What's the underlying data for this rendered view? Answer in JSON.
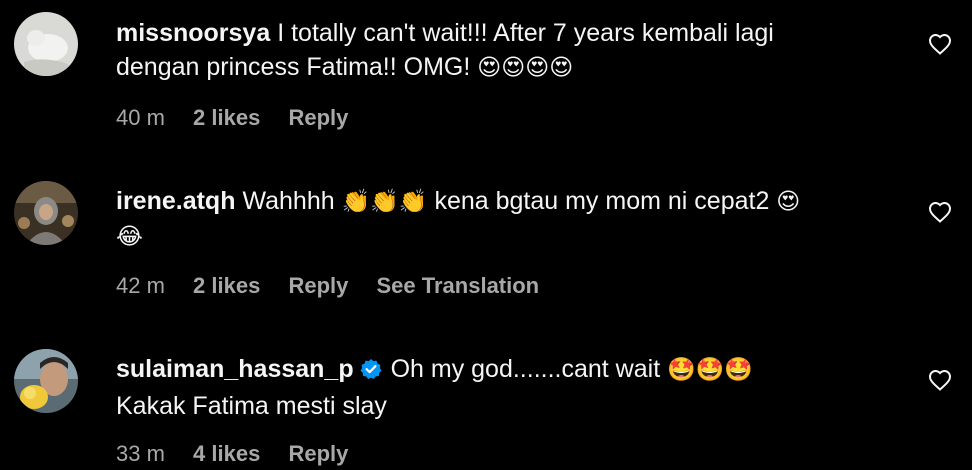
{
  "comments": [
    {
      "username": "missnoorsya",
      "text_line1": "I totally can't wait!!! After 7 years kembali lagi",
      "text_line2": "dengan princess Fatima!! OMG! ",
      "emoji": "😍😍😍😍",
      "time": "40 m",
      "likes": "2 likes",
      "reply": "Reply"
    },
    {
      "username": "irene.atqh",
      "text_a": "Wahhhh ",
      "emoji_a": "👏👏👏",
      "text_b": " kena bgtau my mom ni cepat2 ",
      "emoji_b": "😍",
      "emoji_line2": "😂",
      "time": "42 m",
      "likes": "2 likes",
      "reply": "Reply",
      "translate": "See Translation"
    },
    {
      "username": "sulaiman_hassan_p",
      "verified_icon": "verified-badge-icon",
      "text_line1": "Oh my god.......cant wait ",
      "emoji": "🤩🤩🤩",
      "text_line2": "Kakak Fatima mesti slay",
      "time": "33 m",
      "likes": "4 likes",
      "reply": "Reply"
    }
  ],
  "colors": {
    "background": "#000000",
    "text": "#f5f5f5",
    "meta": "#a8a8a8",
    "verified": "#0095f6"
  },
  "icons": [
    "heart-icon",
    "verified-badge-icon"
  ]
}
